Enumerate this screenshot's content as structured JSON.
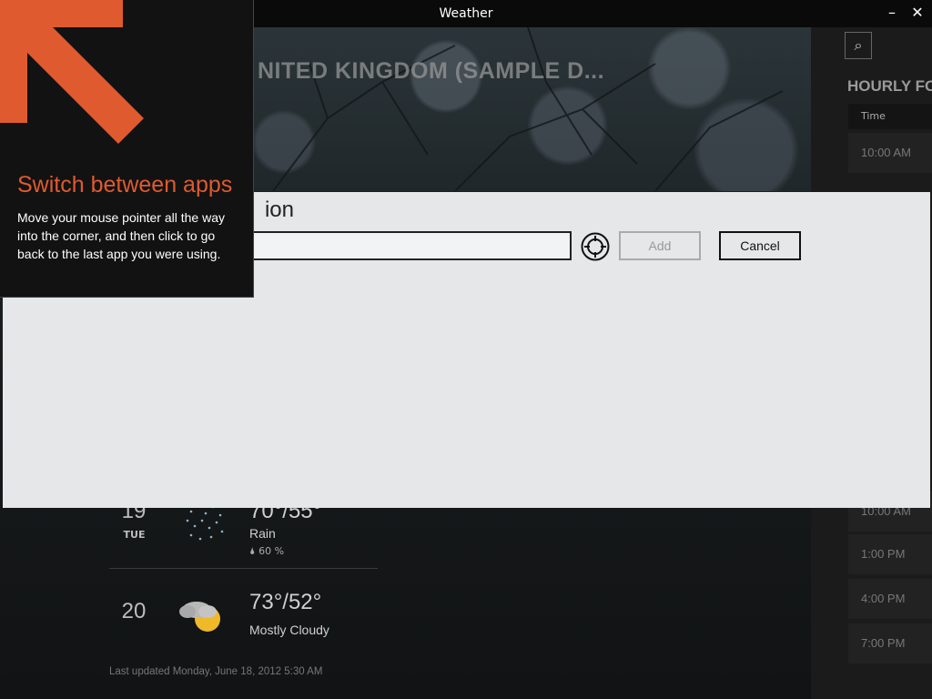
{
  "window": {
    "title": "Weather",
    "minimize_label": "–",
    "close_label": "✕"
  },
  "hero": {
    "city_title": "NITED KINGDOM (SAMPLE D..."
  },
  "forecast": [
    {
      "day": "19",
      "dow": "TUE",
      "temp": "70°/55°",
      "condition": "Rain",
      "precip": "60 %",
      "icon": "rain-icon"
    },
    {
      "day": "20",
      "dow": "",
      "temp": "73°/52°",
      "condition": "Mostly Cloudy",
      "precip": "",
      "icon": "partly-cloudy-icon"
    }
  ],
  "last_updated": "Last updated Monday, June 18, 2012 5:30 AM",
  "hourly": {
    "title": "HOURLY FO",
    "column_header": "Time",
    "times": [
      "10:00 AM",
      "10:00 AM",
      "1:00 PM",
      "4:00 PM",
      "7:00 PM"
    ]
  },
  "dialog": {
    "title": "ion",
    "input_value": "",
    "add_label": "Add",
    "cancel_label": "Cancel"
  },
  "tip": {
    "title": "Switch between apps",
    "body": "Move your mouse pointer all the way into the corner, and then click to go back to the last app you were using."
  },
  "colors": {
    "accent": "#e05a2f",
    "dialog_bg": "#e6e7e9",
    "tip_bg": "#121212"
  }
}
